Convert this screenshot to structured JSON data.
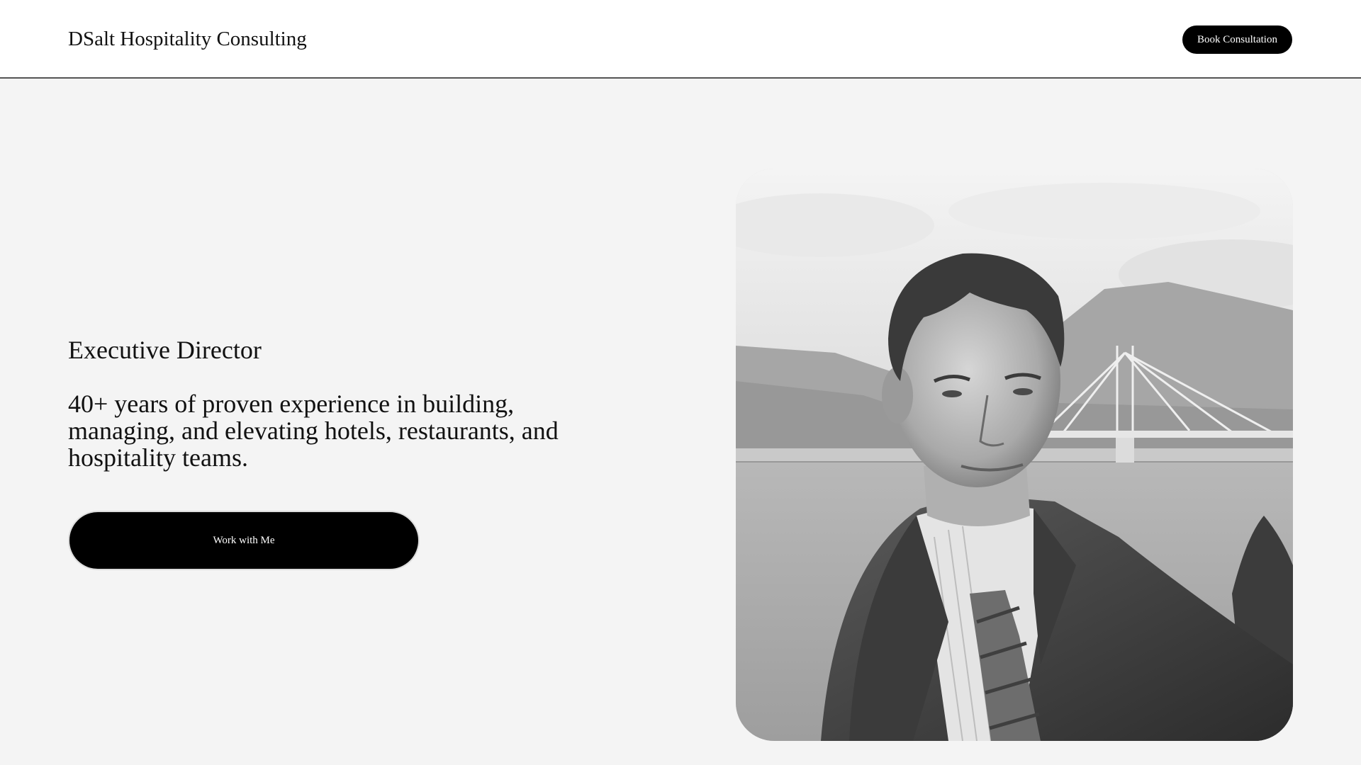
{
  "header": {
    "brand": "DSalt Hospitality Consulting",
    "cta_label": "Book Consultation"
  },
  "hero": {
    "role": "Executive Director",
    "tagline": "40+ years of proven experience in building, managing, and elevating hotels, restaurants, and hospitality teams.",
    "cta_label": "Work with Me",
    "portrait_icon": "portrait-photo"
  },
  "colors": {
    "background": "#f4f4f4",
    "header_bg": "#ffffff",
    "button_bg": "#000000",
    "button_text": "#ffffff"
  }
}
